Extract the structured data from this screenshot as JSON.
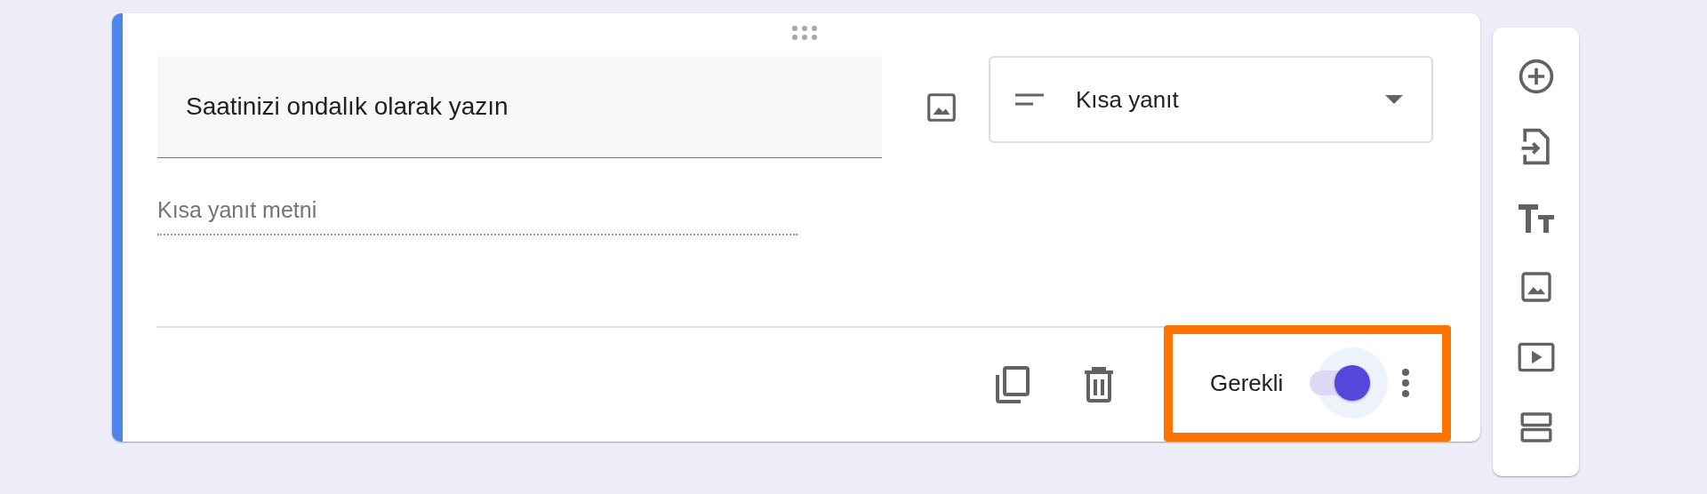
{
  "question": {
    "title": "Saatinizi ondalık olarak yazın",
    "type_label": "Kısa yanıt",
    "answer_placeholder": "Kısa yanıt metni"
  },
  "footer": {
    "required_label": "Gerekli",
    "required_on": true,
    "highlighted": true
  },
  "side_toolbar": {
    "items": [
      {
        "kind": "add"
      },
      {
        "kind": "import"
      },
      {
        "kind": "title"
      },
      {
        "kind": "image"
      },
      {
        "kind": "video"
      },
      {
        "kind": "section"
      }
    ]
  }
}
